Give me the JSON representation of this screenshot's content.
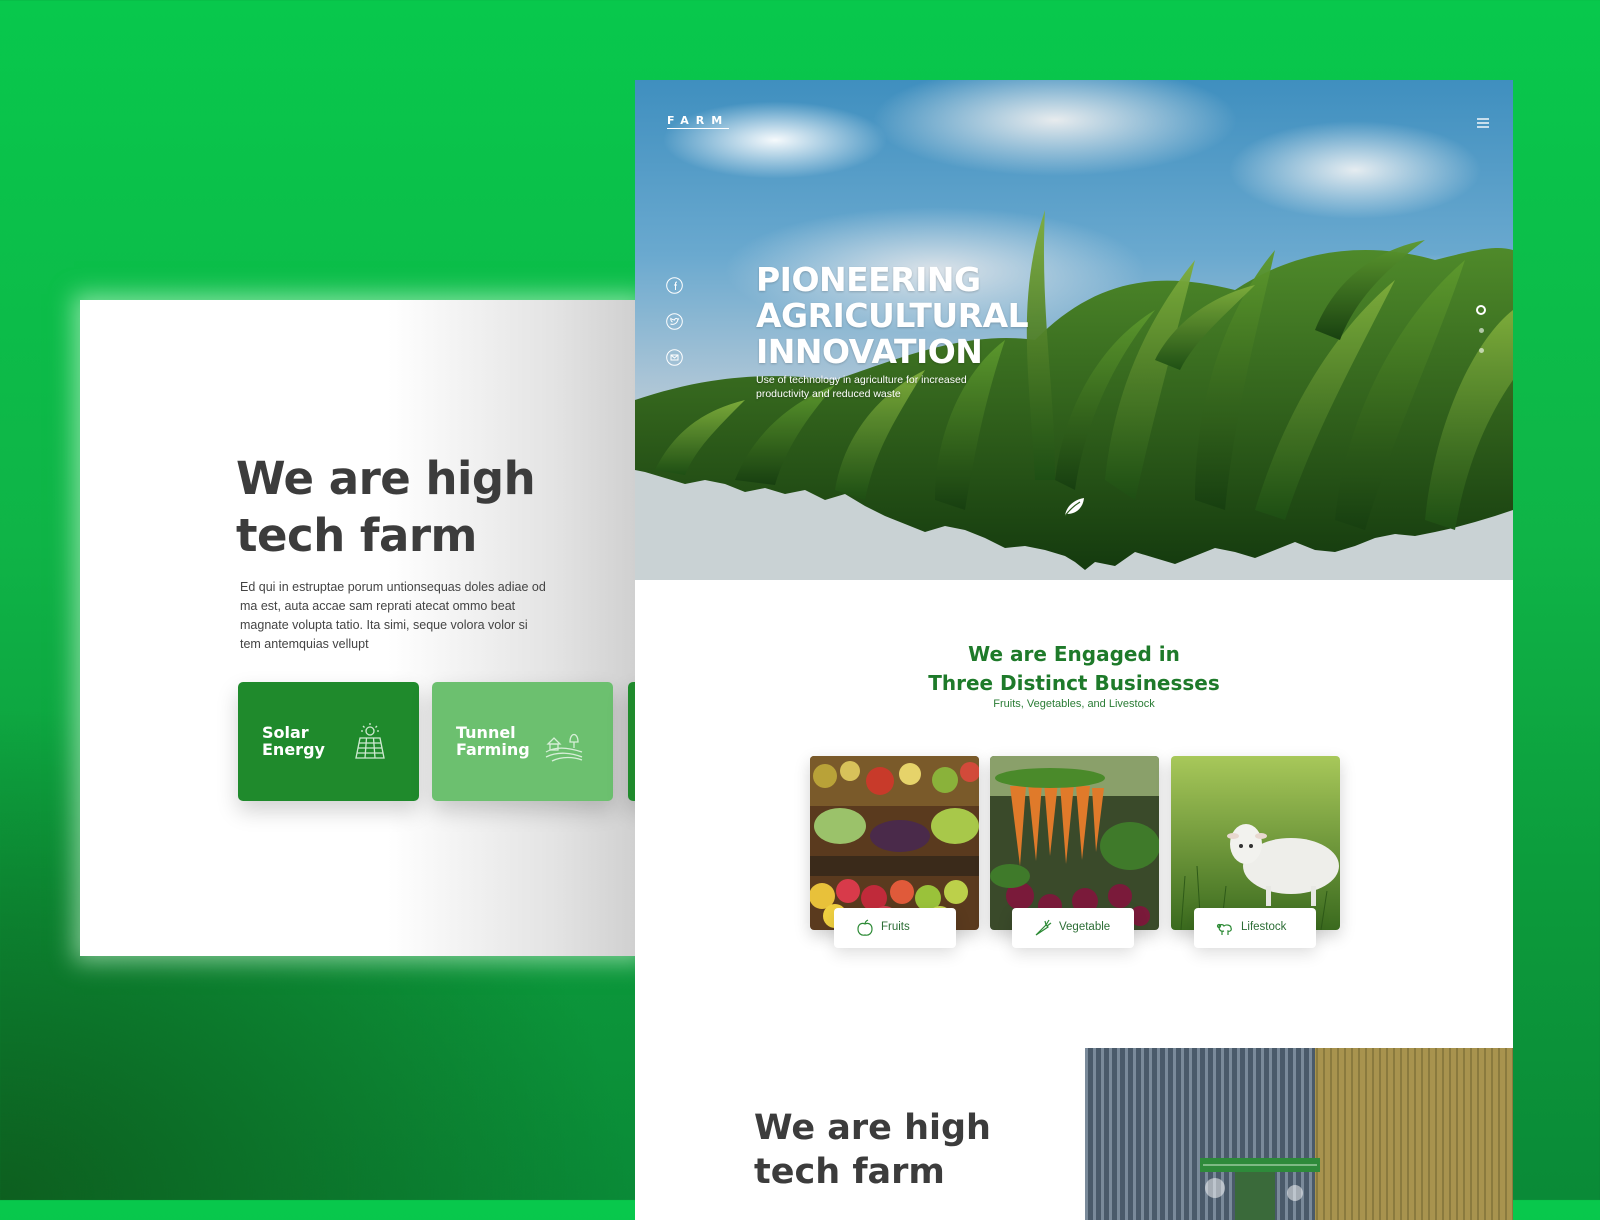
{
  "intro_card": {
    "title": "We are high tech farm",
    "paragraph": "Ed qui in estruptae porum untionsequas doles adiae od ma est, auta accae sam reprati atecat ommo beat magnate volupta tatio. Ita simi, seque volora volor si tem antemquias vellupt",
    "features": [
      {
        "label": "Solar Energy",
        "icon": "solar-panel-icon",
        "color": "#1f8a2c"
      },
      {
        "label": "Tunnel Farming",
        "icon": "farm-field-icon",
        "color": "#6cc06f"
      }
    ]
  },
  "site": {
    "logo": "FARM",
    "nav": {
      "menu_icon": "hamburger-menu-icon"
    },
    "social": [
      "facebook-icon",
      "twitter-icon",
      "email-icon"
    ],
    "hero": {
      "title": "PIONEERING AGRICULTURAL INNOVATION",
      "subtitle": "Use of technology in agriculture for increased productivity and reduced waste",
      "slide_count": 3,
      "active_slide": 1
    },
    "engaged": {
      "title_line1": "We are Engaged in",
      "title_line2": "Three Distinct Businesses",
      "subtitle": "Fruits, Vegetables, and Livestock",
      "businesses": [
        {
          "label": "Fruits",
          "icon": "apple-icon"
        },
        {
          "label": "Vegetable",
          "icon": "carrot-icon"
        },
        {
          "label": "Lifestock",
          "icon": "sheep-icon"
        }
      ]
    },
    "about": {
      "title": "We are high tech farm"
    }
  },
  "colors": {
    "brand_green": "#1e7a2a",
    "light_green": "#6cc06f",
    "background_green": "#0fb447"
  }
}
